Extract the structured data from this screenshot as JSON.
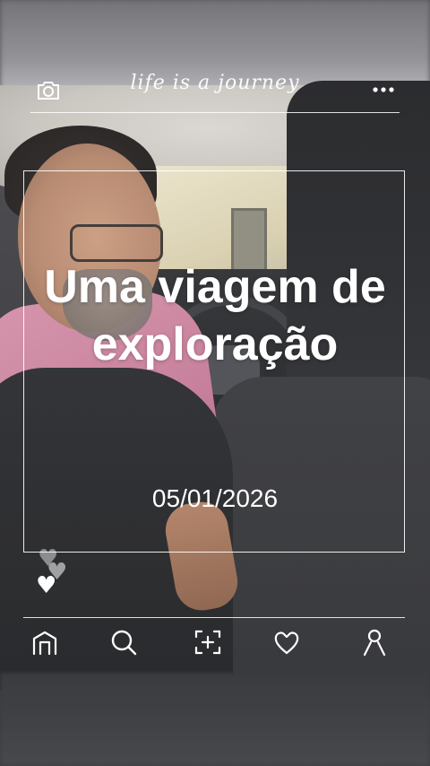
{
  "header": {
    "script_title": "life is a journey",
    "camera_icon": "camera-icon",
    "more_icon": "more-icon"
  },
  "card": {
    "title": "Uma viagem de exploração",
    "date": "05/01/2026"
  },
  "reactions": {
    "icon": "heart-icon"
  },
  "nav": {
    "items": [
      {
        "icon": "home-icon"
      },
      {
        "icon": "search-icon"
      },
      {
        "icon": "add-photo-icon"
      },
      {
        "icon": "heart-outline-icon"
      },
      {
        "icon": "profile-icon"
      }
    ]
  },
  "colors": {
    "overlay_text": "#ffffff",
    "shirt": "#c47a96"
  }
}
